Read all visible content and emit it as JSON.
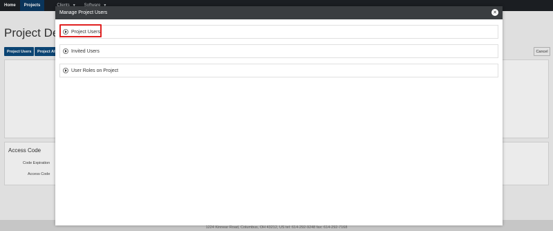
{
  "nav": {
    "home": "Home",
    "projects": "Projects",
    "clients": "Clients",
    "software": "Software"
  },
  "page": {
    "title": "Project Deta",
    "buttons": {
      "project_users": "Project Users",
      "project_alerts": "Project Alli",
      "cancel": "Cancel"
    },
    "access": {
      "title": "Access Code",
      "code_expiration_label": "Code Expiration",
      "access_code_label": "Access Code"
    },
    "footer": "1224 Kinnear Road, Columbus, OH 43212, US   tel: 614-292-9248   fax: 614-292-7168"
  },
  "modal": {
    "title": "Manage Project Users",
    "close_icon": "close-icon",
    "regions": [
      {
        "label": "Project Users",
        "expanded": false
      },
      {
        "label": "Invited Users",
        "expanded": false
      },
      {
        "label": "User Roles on Project",
        "expanded": false
      }
    ],
    "highlight_color": "#e02020"
  },
  "colors": {
    "nav_bg": "#1e2125",
    "nav_active": "#0b3a63",
    "primary_button": "#0c4a7d",
    "modal_header": "#3a3d40"
  }
}
